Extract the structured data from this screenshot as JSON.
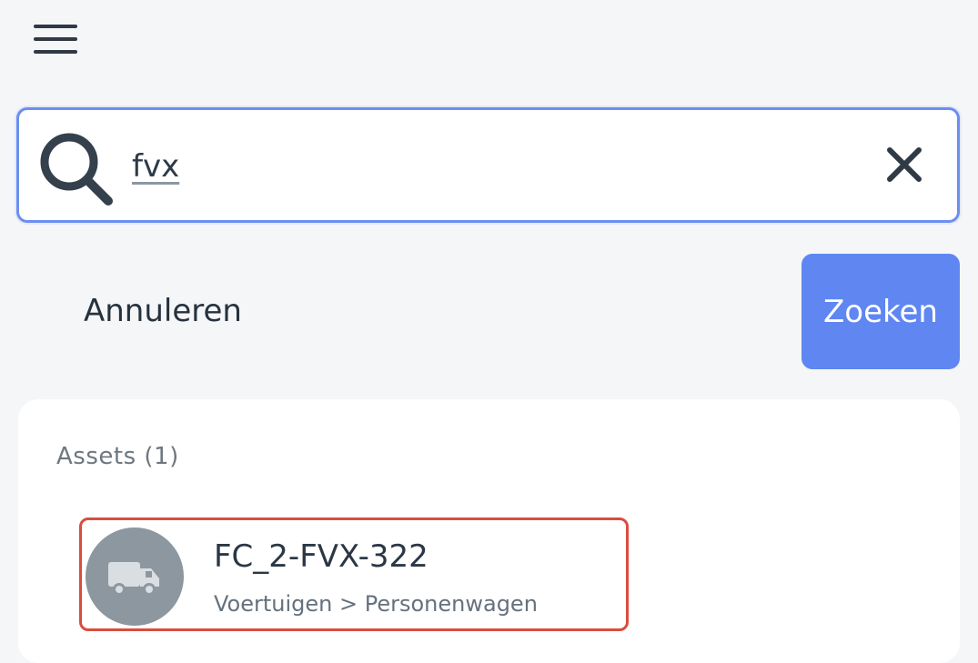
{
  "toolbar": {
    "menu_icon": "hamburger-menu-icon"
  },
  "search": {
    "value": "fvx",
    "search_icon": "magnifier-icon",
    "clear_icon": "close-icon",
    "accent": "#6b8ff0"
  },
  "actions": {
    "cancel_label": "Annuleren",
    "search_label": "Zoeken",
    "search_button_color": "#5f86f1"
  },
  "results": {
    "heading": "Assets (1)",
    "items": [
      {
        "title": "FC_2-FVX-322",
        "subtitle": "Voertuigen > Personenwagen",
        "icon": "truck-icon",
        "highlight_color": "#d94d3c"
      }
    ]
  }
}
